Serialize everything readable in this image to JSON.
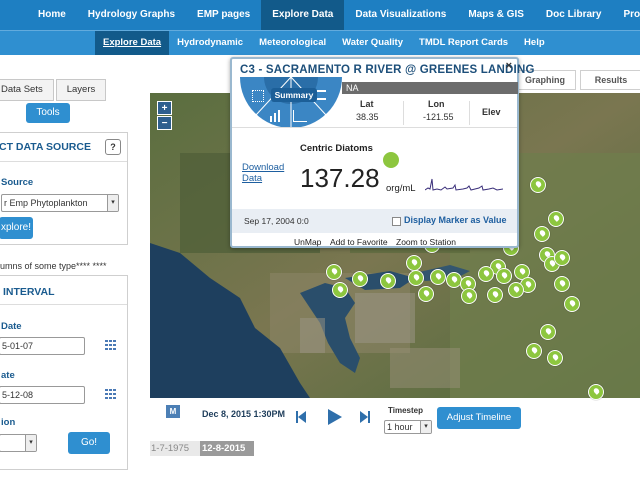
{
  "topnav": {
    "items": [
      "Home",
      "Hydrology Graphs",
      "EMP pages",
      "Explore Data",
      "Data Visualizations",
      "Maps & GIS",
      "Doc Library",
      "Projects"
    ],
    "active": "Explore Data"
  },
  "subnav": {
    "items": [
      "Explore Data",
      "Hydrodynamic",
      "Meteorological",
      "Water Quality",
      "TMDL Report Cards",
      "Help"
    ],
    "active": "Explore Data"
  },
  "left": {
    "tabs": [
      "Data Sets",
      "Layers"
    ],
    "tools_label": "Tools",
    "source_box": {
      "title": "CT DATA SOURCE",
      "help": "?",
      "source_label": "Source",
      "source_value": "r Emp Phytoplankton",
      "explore_label": "xplore!"
    },
    "columns_note": "umns of some type**** ****",
    "interval_box": {
      "title": "INTERVAL",
      "start_label": "Date",
      "start_value": "5-01-07",
      "end_label": "ate",
      "end_value": "5-12-08",
      "agg_label": "ion",
      "go_label": "Go!"
    }
  },
  "right_tabs": [
    "Graphing",
    "Results"
  ],
  "map": {
    "zoom_in": "+",
    "zoom_out": "−"
  },
  "popup": {
    "title": "C3 - SACRAMENTO R RIVER @ GREENES LANDING",
    "close": "×",
    "summary_label": "Summary",
    "strip_text": "NA",
    "lat_label": "Lat",
    "lat_value": "38.35",
    "lon_label": "Lon",
    "lon_value": "-121.55",
    "elev_label": "Elev",
    "param_name": "Centric Diatoms",
    "download_label": "Download Data",
    "value": "137.28",
    "unit": "org/mL",
    "date": "Sep 17, 2004 0:0",
    "checkbox_label": "Display Marker as Value",
    "links": [
      "UnMap",
      "Add to Favorite",
      "Zoom to Station"
    ]
  },
  "timeline": {
    "m_label": "M",
    "datetime": "Dec 8, 2015 1:30PM",
    "timestep_label": "Timestep",
    "timestep_value": "1 hour",
    "adjust_label": "Adjust Timeline",
    "range_start": "1-7-1975",
    "range_end": "12-8-2015"
  },
  "colors": {
    "nav": "#1e7fc2",
    "subnav": "#2f8fd0",
    "active": "#125a8a",
    "marker": "#8dc63f",
    "title": "#1d4f7a"
  },
  "icons": [
    "grid-icon",
    "bar-chart-icon",
    "chart-icon",
    "calendar-icon",
    "skip-back-icon",
    "play-icon",
    "skip-forward-icon",
    "close-icon",
    "station-marker-icon"
  ]
}
